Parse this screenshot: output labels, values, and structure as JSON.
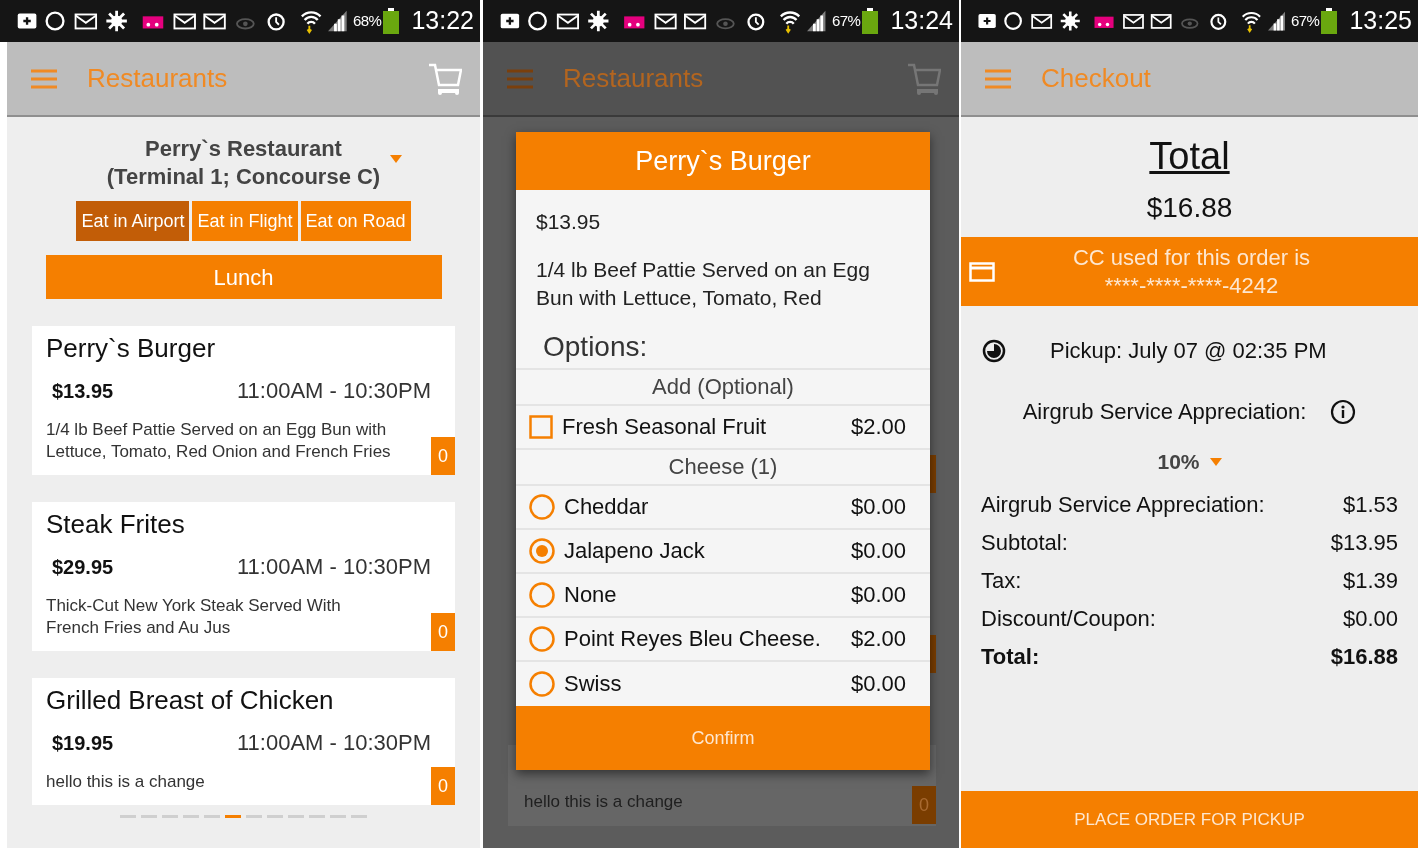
{
  "screens": [
    {
      "kind": "menu",
      "status_bar": {
        "battery": "68%",
        "time": "13:22"
      },
      "app_bar": {
        "title": "Restaurants",
        "cart": true,
        "dimmed": false
      },
      "restaurant": {
        "name": "Perry`s Restaurant",
        "location": "(Terminal 1; Concourse C)"
      },
      "tabs": [
        {
          "label": "Eat in Airport",
          "selected": true
        },
        {
          "label": "Eat in Flight",
          "selected": false
        },
        {
          "label": "Eat on Road",
          "selected": false
        }
      ],
      "meal": "Lunch",
      "items": [
        {
          "name": "Perry`s Burger",
          "price": "$13.95",
          "hours": "11:00AM - 10:30PM",
          "description": "1/4 lb Beef Pattie Served on an Egg Bun with Lettuce, Tomato, Red Onion and French Fries",
          "count": "0"
        },
        {
          "name": "Steak Frites",
          "price": "$29.95",
          "hours": "11:00AM - 10:30PM",
          "description": "Thick-Cut New York Steak Served With French Fries and Au Jus",
          "count": "0"
        },
        {
          "name": "Grilled Breast of Chicken",
          "price": "$19.95",
          "hours": "11:00AM - 10:30PM",
          "description": "hello this is a change",
          "count": "0"
        }
      ],
      "pager": [
        {
          "selected": false
        },
        {
          "selected": false
        },
        {
          "selected": false
        },
        {
          "selected": false
        },
        {
          "selected": false
        },
        {
          "selected": true
        },
        {
          "selected": false
        },
        {
          "selected": false
        },
        {
          "selected": false
        },
        {
          "selected": false
        },
        {
          "selected": false
        },
        {
          "selected": false
        }
      ]
    },
    {
      "kind": "dialog",
      "status_bar": {
        "battery": "67%",
        "time": "13:24"
      },
      "app_bar": {
        "title": "Restaurants",
        "cart": true,
        "dimmed": true
      },
      "background_item": {
        "description": "hello this is a change",
        "count": "0"
      },
      "dialog": {
        "title": "Perry`s Burger",
        "price": "$13.95",
        "description": "1/4 lb Beef Pattie Served on an Egg Bun with Lettuce, Tomato, Red",
        "options_heading": "Options:",
        "groups": [
          {
            "title": "Add (Optional)",
            "kind": "checkbox",
            "options": [
              {
                "name": "Fresh Seasonal Fruit",
                "price": "$2.00",
                "checked": false
              }
            ]
          },
          {
            "title": "Cheese (1)",
            "kind": "radio",
            "options": [
              {
                "name": "Cheddar",
                "price": "$0.00",
                "selected": false
              },
              {
                "name": "Jalapeno Jack",
                "price": "$0.00",
                "selected": true
              },
              {
                "name": "None",
                "price": "$0.00",
                "selected": false
              },
              {
                "name": "Point Reyes Bleu Cheese.",
                "price": "$2.00",
                "selected": false
              },
              {
                "name": "Swiss",
                "price": "$0.00",
                "selected": false
              }
            ]
          }
        ],
        "confirm": "Confirm"
      }
    },
    {
      "kind": "checkout",
      "status_bar": {
        "battery": "67%",
        "time": "13:25"
      },
      "app_bar": {
        "title": "Checkout",
        "cart": false,
        "dimmed": false
      },
      "total_heading": "Total",
      "total": "$16.88",
      "card_notice": {
        "text": "CC used for this order is",
        "number": "****-****-****-4242"
      },
      "pickup": "Pickup: July 07 @ 02:35 PM",
      "appreciation_label": "Airgrub Service Appreciation:",
      "appreciation_percent": "10%",
      "summary": [
        {
          "label": "Airgrub Service Appreciation:",
          "value": "$1.53",
          "bold": false
        },
        {
          "label": "Subtotal:",
          "value": "$13.95",
          "bold": false
        },
        {
          "label": "Tax:",
          "value": "$1.39",
          "bold": false
        },
        {
          "label": "Discount/Coupon:",
          "value": "$0.00",
          "bold": false
        },
        {
          "label": "Total:",
          "value": "$16.88",
          "bold": true
        }
      ],
      "place_order": "PLACE ORDER FOR PICKUP"
    }
  ]
}
